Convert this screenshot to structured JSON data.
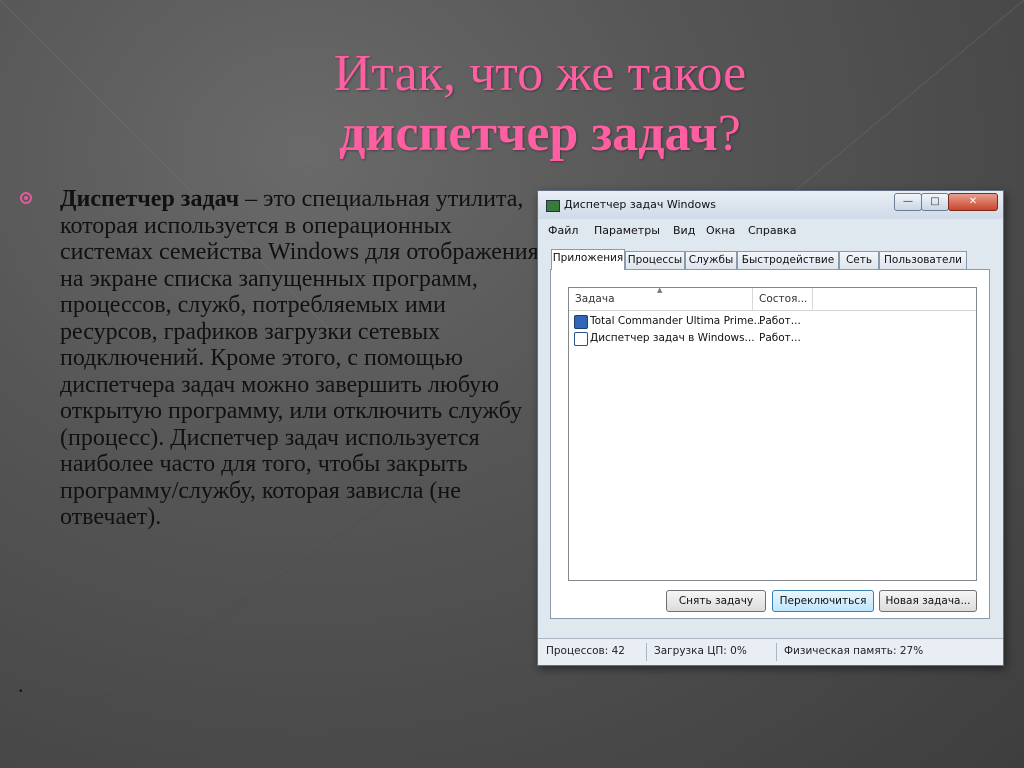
{
  "slide": {
    "title_line1": "Итак, что же такое",
    "title_line2_bold": "диспетчер задач",
    "title_line2_end": "?",
    "bullet_bold": "Диспетчер задач",
    "bullet_text": " – это специальная утилита, которая используется в операционных системах семейства Windows для отображения на экране списка запущенных программ, процессов, служб, потребляемых ими ресурсов, графиков загрузки сетевых подключений. Кроме этого, с помощью диспетчера задач можно завершить любую открытую программу, или отключить службу (процесс). Диспетчер задач используется наиболее часто для того, чтобы закрыть программу/службу, которая зависла (не отвечает).",
    "footer_dot": ".",
    "colors": {
      "title": "#ff5fa2",
      "bullet": "#e25b9b",
      "body_text": "#111111"
    }
  },
  "window": {
    "title": "Диспетчер задач Windows",
    "controls": {
      "minimize": "—",
      "maximize": "□",
      "close": "✕"
    },
    "menu": [
      "Файл",
      "Параметры",
      "Вид",
      "Окна",
      "Справка"
    ],
    "tabs": [
      "Приложения",
      "Процессы",
      "Службы",
      "Быстродействие",
      "Сеть",
      "Пользователи"
    ],
    "active_tab": "Приложения",
    "columns": {
      "task": "Задача",
      "status": "Состоя..."
    },
    "rows": [
      {
        "task": "Total Commander Ultima Prime...",
        "status": "Работ...",
        "icon": "total-commander-icon"
      },
      {
        "task": "Диспетчер задач в Windows...",
        "status": "Работ...",
        "icon": "document-icon"
      }
    ],
    "buttons": {
      "end_task": "Снять задачу",
      "switch_to": "Переключиться",
      "new_task": "Новая задача..."
    },
    "statusbar": {
      "processes": "Процессов: 42",
      "cpu": "Загрузка ЦП: 0%",
      "memory": "Физическая память: 27%"
    }
  }
}
